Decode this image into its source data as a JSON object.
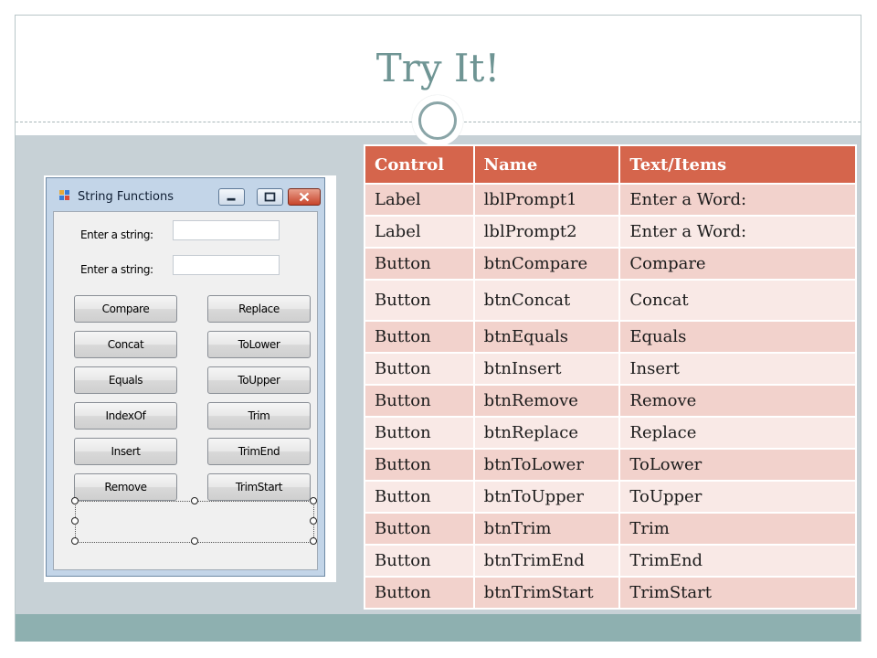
{
  "slide": {
    "title": "Try It!"
  },
  "window": {
    "title": "String Functions",
    "icons": {
      "app": "app-form-icon",
      "minimize": "minimize-icon",
      "maximize": "maximize-icon",
      "close": "close-icon"
    },
    "prompts": [
      "Enter a string:",
      "Enter a string:"
    ],
    "buttons_left": [
      "Compare",
      "Concat",
      "Equals",
      "IndexOf",
      "Insert",
      "Remove"
    ],
    "buttons_right": [
      "Replace",
      "ToLower",
      "ToUpper",
      "Trim",
      "TrimEnd",
      "TrimStart"
    ]
  },
  "table": {
    "headers": [
      "Control",
      "Name",
      "Text/Items"
    ],
    "rows": [
      [
        "Label",
        "lblPrompt1",
        "Enter a Word:"
      ],
      [
        "Label",
        "lblPrompt2",
        "Enter a Word:"
      ],
      [
        "Button",
        "btnCompare",
        "Compare"
      ],
      [
        "Button",
        "btnConcat",
        "Concat"
      ],
      [
        "Button",
        "btnEquals",
        "Equals"
      ],
      [
        "Button",
        "btnInsert",
        "Insert"
      ],
      [
        "Button",
        "btnRemove",
        "Remove"
      ],
      [
        "Button",
        "btnReplace",
        "Replace"
      ],
      [
        "Button",
        "btnToLower",
        "ToLower"
      ],
      [
        "Button",
        "btnToUpper",
        "ToUpper"
      ],
      [
        "Button",
        "btnTrim",
        "Trim"
      ],
      [
        "Button",
        "btnTrimEnd",
        "TrimEnd"
      ],
      [
        "Button",
        "btnTrimStart",
        "TrimStart"
      ]
    ]
  },
  "colors": {
    "title": "#6f9594",
    "header": "#d5654c",
    "row_odd": "#f2d2cc",
    "row_even": "#f9e9e6",
    "band": "#c7d1d6",
    "footer": "#8eb0b0"
  }
}
